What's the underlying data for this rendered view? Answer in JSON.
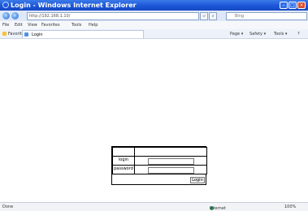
{
  "window": {
    "title": "Login - Windows Internet Explorer",
    "buttons": [
      "–",
      "□",
      "×"
    ]
  },
  "address": {
    "url": "http://192.168.1.10/",
    "go_btn": "⏎",
    "refresh_btn": "×",
    "search_placeholder": "Bing"
  },
  "menu": [
    "File",
    "Edit",
    "View",
    "Favorites",
    "Tools",
    "Help"
  ],
  "favorites": {
    "label": "Favorites",
    "tab_title": "Login",
    "tools": [
      "Page ▾",
      "Safety ▾",
      "Tools ▾",
      "?"
    ]
  },
  "form": {
    "login_label": "login",
    "password_label": "password",
    "button_label": "Login"
  },
  "status": {
    "left": "Done",
    "zone": "Internet",
    "zoom": "100%"
  },
  "colors": {
    "titlebar": "#1c56d8",
    "accent": "#2b6fdc"
  }
}
